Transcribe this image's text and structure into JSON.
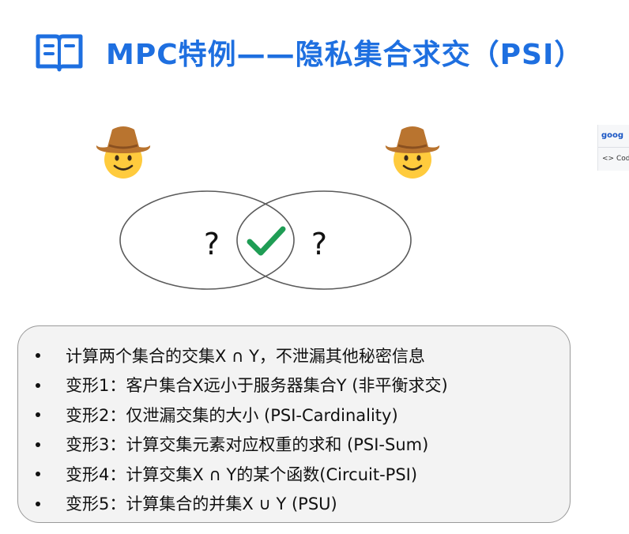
{
  "header": {
    "title": "MPC特例——隐私集合求交（PSI）",
    "icon": "book-icon",
    "accent_color": "#1e6fe0"
  },
  "diagram": {
    "left_party_icon": "cowboy-face-icon",
    "right_party_icon": "cowboy-face-icon",
    "left_mark": "?",
    "right_mark": "?",
    "intersection_icon": "check-mark-icon",
    "check_color": "#1f9d55"
  },
  "bullets": [
    "计算两个集合的交集X ∩ Y，不泄漏其他秘密信息",
    "变形1：客户集合X远小于服务器集合Y (非平衡求交)",
    "变形2：仅泄漏交集的大小 (PSI-Cardinality)",
    "变形3：计算交集元素对应权重的求和 (PSI-Sum)",
    "变形4：计算交集X ∩ Y的某个函数(Circuit-PSI)",
    "变形5：计算集合的并集X ∪ Y (PSU)"
  ],
  "side_clip": {
    "line1": "goog",
    "line2": "<> Code"
  }
}
